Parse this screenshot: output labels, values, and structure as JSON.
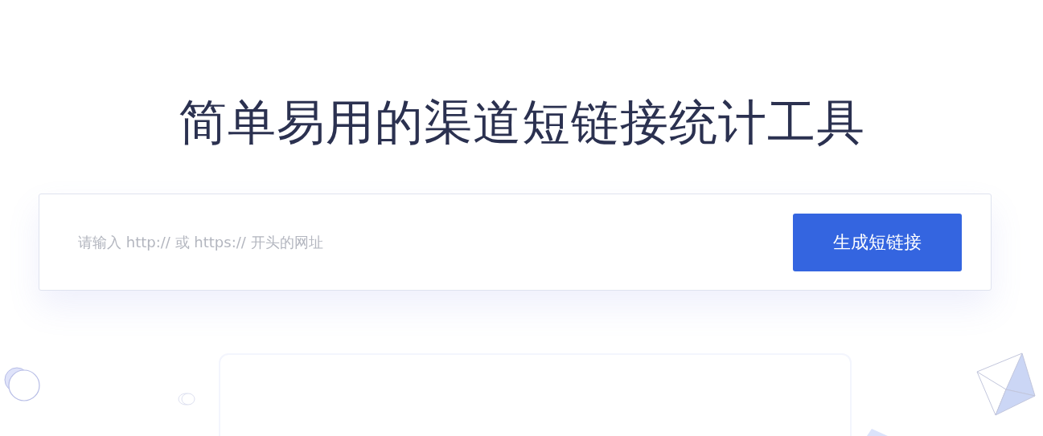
{
  "hero": {
    "title": "简单易用的渠道短链接统计工具"
  },
  "shortener": {
    "placeholder": "请输入 http:// 或 https:// 开头的网址",
    "button": "生成短链接"
  }
}
